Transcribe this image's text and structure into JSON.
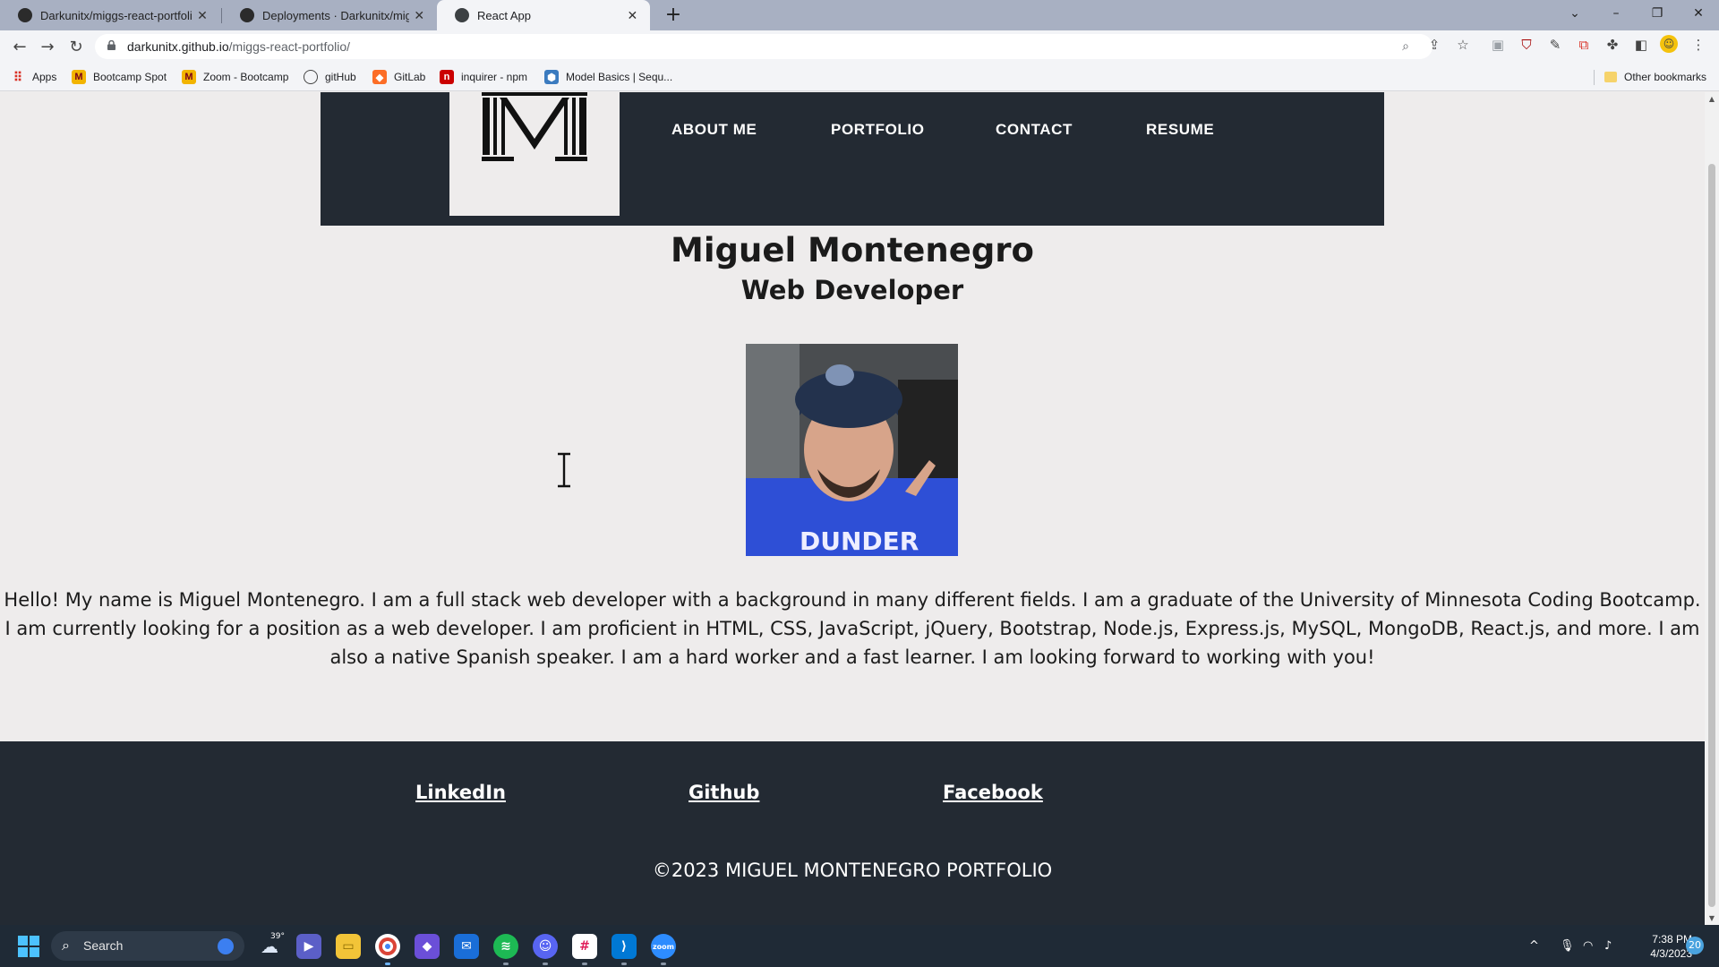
{
  "browser": {
    "tabs": [
      {
        "label": "Darkunitx/miggs-react-portfolio",
        "close": "✕"
      },
      {
        "label": "Deployments · Darkunitx/miggs-",
        "close": "✕"
      },
      {
        "label": "React App",
        "close": "✕"
      }
    ],
    "new_tab": "+",
    "url_host": "darkunitx.github.io",
    "url_path": "/miggs-react-portfolio/",
    "bookmarks": [
      {
        "label": "Apps",
        "icon": "apps-grid-icon"
      },
      {
        "label": "Bootcamp Spot",
        "icon": "bootcamp-icon"
      },
      {
        "label": "Zoom - Bootcamp",
        "icon": "bootcamp-icon"
      },
      {
        "label": "gitHub",
        "icon": "github-icon"
      },
      {
        "label": "GitLab",
        "icon": "gitlab-icon"
      },
      {
        "label": "inquirer - npm",
        "icon": "npm-icon"
      },
      {
        "label": "Model Basics | Sequ...",
        "icon": "sequelize-icon"
      }
    ],
    "other_bookmarks": "Other bookmarks"
  },
  "page": {
    "nav": [
      "ABOUT ME",
      "PORTFOLIO",
      "CONTACT",
      "RESUME"
    ],
    "name": "Miguel Montenegro",
    "title": "Web Developer",
    "bio": "Hello! My name is Miguel Montenegro. I am a full stack web developer with a background in many different fields. I am a graduate of the University of Minnesota Coding Bootcamp. I am currently looking for a position as a web developer. I am proficient in HTML, CSS, JavaScript, jQuery, Bootstrap, Node.js, Express.js, MySQL, MongoDB, React.js, and more. I am also a native Spanish speaker. I am a hard worker and a fast learner. I am looking forward to working with you!",
    "footer_links": [
      "LinkedIn",
      "Github",
      "Facebook"
    ],
    "copyright": "©2023 MIGUEL MONTENEGRO PORTFOLIO"
  },
  "taskbar": {
    "search_label": "Search",
    "weather": "39°",
    "time": "7:38 PM",
    "date": "4/3/2023",
    "notifications": "20"
  },
  "colors": {
    "header_bg": "#232a33",
    "page_bg": "#eeecec",
    "tabbar_bg": "#a8b0c2",
    "taskbar_bg": "#1f2a36"
  }
}
